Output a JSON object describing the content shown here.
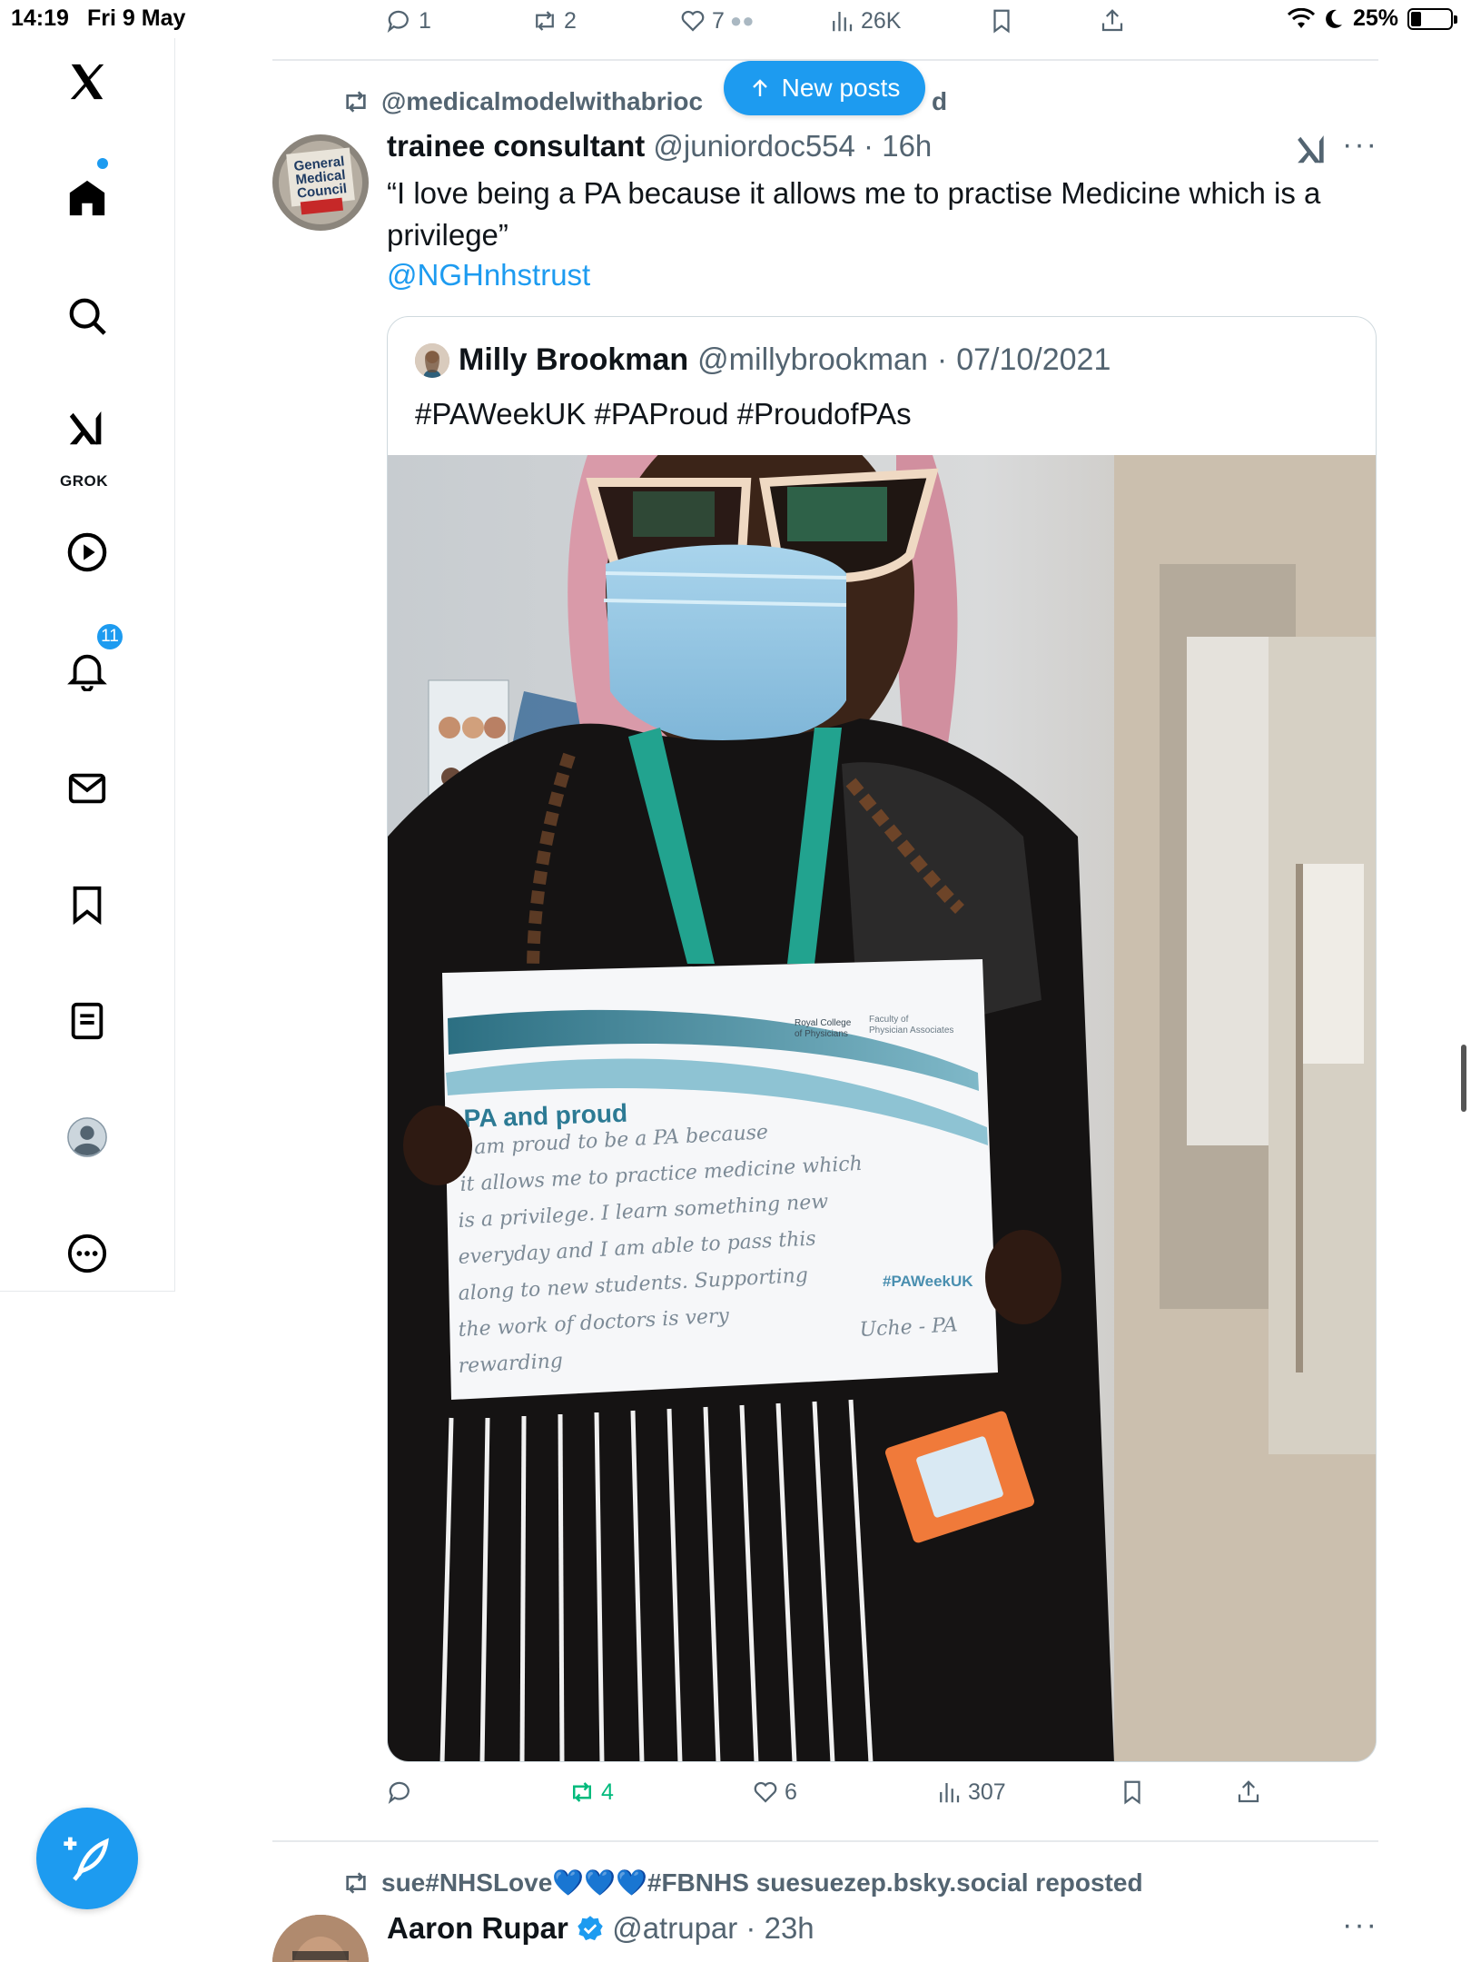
{
  "status_bar": {
    "time": "14:19",
    "date": "Fri 9 May",
    "battery": "25%",
    "battery_level": 0.25
  },
  "sidebar": {
    "logo": "x-logo",
    "items": [
      {
        "name": "home",
        "icon": "home-icon",
        "badge": ""
      },
      {
        "name": "explore",
        "icon": "search-icon",
        "badge": ""
      },
      {
        "name": "grok",
        "icon": "grok-icon",
        "label": "GROK"
      },
      {
        "name": "videos",
        "icon": "play-icon",
        "badge": ""
      },
      {
        "name": "notifications",
        "icon": "bell-icon",
        "badge": "11"
      },
      {
        "name": "messages",
        "icon": "mail-icon",
        "badge": ""
      },
      {
        "name": "bookmarks",
        "icon": "bookmark-icon",
        "badge": ""
      },
      {
        "name": "lists",
        "icon": "list-icon",
        "badge": ""
      },
      {
        "name": "profile",
        "icon": "avatar-icon",
        "badge": ""
      },
      {
        "name": "more",
        "icon": "more-icon",
        "badge": ""
      }
    ]
  },
  "previous_post_actions": {
    "replies": "1",
    "reposts": "2",
    "likes": "7",
    "views": "26K"
  },
  "new_posts_pill": {
    "label": "New posts"
  },
  "post": {
    "repost_by": "@medicalmodelwithabrioc",
    "repost_suffix": "d",
    "avatar_text_1": "General",
    "avatar_text_2": "Medical",
    "avatar_text_3": "Council",
    "author_name": "trainee consultant",
    "author_handle": "@juniordoc554",
    "time": "16h",
    "text": "“I love being a PA because it allows me to practise Medicine which is a privilege”",
    "mention": "@NGHnhstrust",
    "quote": {
      "author_name": "Milly Brookman",
      "author_handle": "@millybrookman",
      "date": "07/10/2021",
      "text": "#PAWeekUK #PAProud #ProudofPAs",
      "photo": {
        "sign_logo_1": "Royal College",
        "sign_logo_2": "of Physicians",
        "sign_logo_3": "Faculty of",
        "sign_logo_4": "Physician Associates",
        "sign_title": "PA and proud",
        "handwriting": [
          "I am proud to be a PA because",
          "it allows me to practice medicine which",
          "is a privilege. I learn something new",
          "everyday and I am able to pass this",
          "along to new students. Supporting",
          "the work of doctors is very",
          "rewarding",
          "Uche - PA"
        ],
        "hashtag": "#PAWeekUK"
      }
    },
    "actions": {
      "replies": "",
      "reposts": "4",
      "likes": "6",
      "views": "307"
    }
  },
  "next_post": {
    "repost_by": "sue#NHSLove💙💙💙#FBNHS suesuezep.bsky.social reposted",
    "author_name": "Aaron Rupar",
    "author_handle": "@atrupar",
    "time": "23h"
  },
  "colors": {
    "accent": "#1d9bf0",
    "repost_green": "#00ba7c",
    "muted": "#536471"
  }
}
